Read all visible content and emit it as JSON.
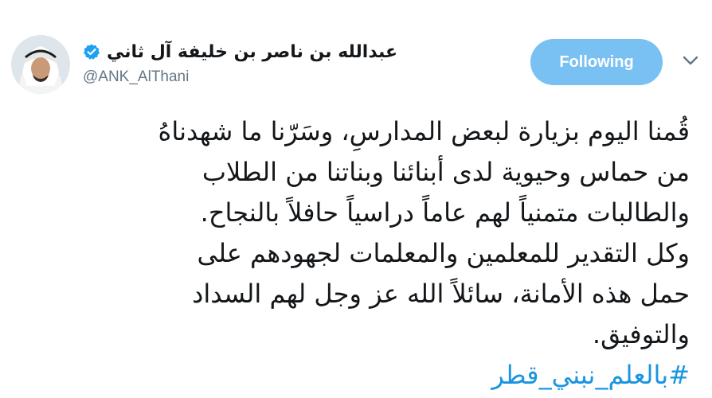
{
  "author": {
    "display_name": "عبدالله بن ناصر بن خليفة آل ثاني",
    "handle": "@ANK_AlThani",
    "verified_icon": "verified-badge-icon",
    "avatar_icon": "profile-avatar"
  },
  "actions": {
    "follow_label": "Following",
    "menu_icon": "chevron-down-icon"
  },
  "tweet": {
    "lines": [
      "قُمنا اليوم بزيارة لبعض المدارسِ، وسَرّنا ما شهدناهُ",
      "من حماس وحيوية لدى أبنائنا وبناتنا من الطلاب",
      "والطالبات متمنياً لهم عاماً دراسياً حافلاً بالنجاح.",
      "وكل التقدير للمعلمين والمعلمات لجهودهم على",
      "حمل هذه الأمانة، سائلاً الله عز وجل لهم السداد",
      "والتوفيق."
    ],
    "hashtag": "#بالعلم_نبني_قطر"
  },
  "colors": {
    "follow_button": "#79c1f2",
    "verified": "#1da1f2",
    "hashtag": "#1b95e0",
    "text": "#14171a",
    "secondary_text": "#657786"
  }
}
